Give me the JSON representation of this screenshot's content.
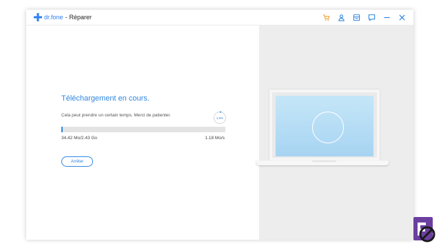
{
  "titlebar": {
    "brand": "dr.fone",
    "separator": "-",
    "title": "Réparer",
    "icons": [
      "cart-icon",
      "user-icon",
      "save-icon",
      "feedback-icon",
      "minimize-icon",
      "close-icon"
    ]
  },
  "download": {
    "heading": "Téléchargement en cours.",
    "subtitle": "Cela peut prendre un certain temps. Merci de patienter.",
    "percent_label": "1.0%",
    "progress_fraction": 0.01,
    "downloaded": "34.42 Mo/2.43 Go",
    "speed": "1.18 Mo/s",
    "stop_label": "Arrêter"
  },
  "colors": {
    "accent": "#2f86e0",
    "toolbar_orange": "#f0a030",
    "toolbar_blue": "#2f86e0",
    "right_pane_bg": "#ededed",
    "watermark_purple": "#6b3fa0"
  }
}
